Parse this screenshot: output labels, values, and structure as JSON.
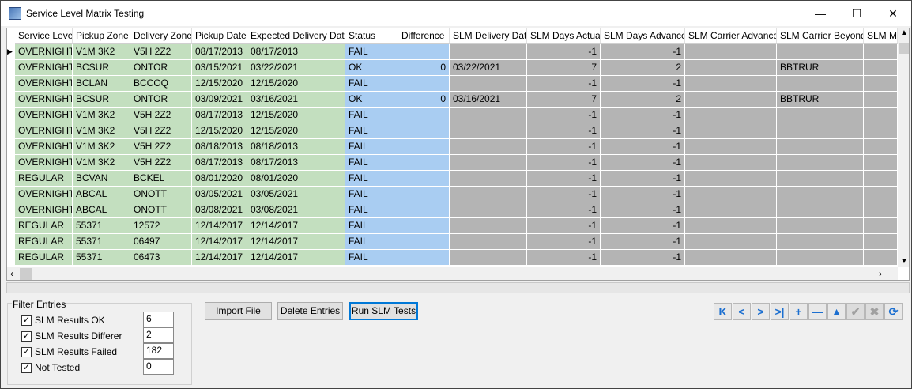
{
  "window": {
    "title": "Service Level Matrix Testing",
    "minimize": "—",
    "maximize": "☐",
    "close": "✕"
  },
  "grid": {
    "columns": [
      "Service Level",
      "Pickup Zone",
      "Delivery Zone",
      "Pickup Date",
      "Expected Delivery Date",
      "Status",
      "Difference",
      "SLM Delivery Date",
      "SLM Days Actual",
      "SLM Days Advance",
      "SLM Carrier Advance",
      "SLM Carrier Beyond",
      "SLM Ma"
    ],
    "rows": [
      [
        "OVERNIGHT",
        "V1M 3K2",
        "V5H 2Z2",
        "08/17/2013",
        "08/17/2013",
        "FAIL",
        "",
        "",
        "-1",
        "-1",
        "",
        "",
        ""
      ],
      [
        "OVERNIGHT",
        "BCSUR",
        "ONTOR",
        "03/15/2021",
        "03/22/2021",
        "OK",
        "0",
        "03/22/2021",
        "7",
        "2",
        "",
        "BBTRUR",
        ""
      ],
      [
        "OVERNIGHT",
        "BCLAN",
        "BCCOQ",
        "12/15/2020",
        "12/15/2020",
        "FAIL",
        "",
        "",
        "-1",
        "-1",
        "",
        "",
        ""
      ],
      [
        "OVERNIGHT",
        "BCSUR",
        "ONTOR",
        "03/09/2021",
        "03/16/2021",
        "OK",
        "0",
        "03/16/2021",
        "7",
        "2",
        "",
        "BBTRUR",
        ""
      ],
      [
        "OVERNIGHT",
        "V1M 3K2",
        "V5H 2Z2",
        "08/17/2013",
        "12/15/2020",
        "FAIL",
        "",
        "",
        "-1",
        "-1",
        "",
        "",
        ""
      ],
      [
        "OVERNIGHT",
        "V1M 3K2",
        "V5H 2Z2",
        "12/15/2020",
        "12/15/2020",
        "FAIL",
        "",
        "",
        "-1",
        "-1",
        "",
        "",
        ""
      ],
      [
        "OVERNIGHT",
        "V1M 3K2",
        "V5H 2Z2",
        "08/18/2013",
        "08/18/2013",
        "FAIL",
        "",
        "",
        "-1",
        "-1",
        "",
        "",
        ""
      ],
      [
        "OVERNIGHT",
        "V1M 3K2",
        "V5H 2Z2",
        "08/17/2013",
        "08/17/2013",
        "FAIL",
        "",
        "",
        "-1",
        "-1",
        "",
        "",
        ""
      ],
      [
        "REGULAR",
        "BCVAN",
        "BCKEL",
        "08/01/2020",
        "08/01/2020",
        "FAIL",
        "",
        "",
        "-1",
        "-1",
        "",
        "",
        ""
      ],
      [
        "OVERNIGHT",
        "ABCAL",
        "ONOTT",
        "03/05/2021",
        "03/05/2021",
        "FAIL",
        "",
        "",
        "-1",
        "-1",
        "",
        "",
        ""
      ],
      [
        "OVERNIGHT",
        "ABCAL",
        "ONOTT",
        "03/08/2021",
        "03/08/2021",
        "FAIL",
        "",
        "",
        "-1",
        "-1",
        "",
        "",
        ""
      ],
      [
        "REGULAR",
        "55371",
        "12572",
        "12/14/2017",
        "12/14/2017",
        "FAIL",
        "",
        "",
        "-1",
        "-1",
        "",
        "",
        ""
      ],
      [
        "REGULAR",
        "55371",
        "06497",
        "12/14/2017",
        "12/14/2017",
        "FAIL",
        "",
        "",
        "-1",
        "-1",
        "",
        "",
        ""
      ],
      [
        "REGULAR",
        "55371",
        "06473",
        "12/14/2017",
        "12/14/2017",
        "FAIL",
        "",
        "",
        "-1",
        "-1",
        "",
        "",
        ""
      ]
    ]
  },
  "filter": {
    "title": "Filter Entries",
    "items": [
      {
        "label": "SLM Results OK",
        "checked": true,
        "count": "6"
      },
      {
        "label": "SLM Results Differer",
        "checked": true,
        "count": "2"
      },
      {
        "label": "SLM Results Failed",
        "checked": true,
        "count": "182"
      },
      {
        "label": "Not Tested",
        "checked": true,
        "count": "0"
      }
    ]
  },
  "buttons": {
    "import": "Import File",
    "delete": "Delete Entries",
    "run": "Run SLM Tests"
  },
  "navigator": [
    {
      "icon": "first-record-icon",
      "glyph": "K",
      "enabled": true
    },
    {
      "icon": "prior-record-icon",
      "glyph": "<",
      "enabled": true
    },
    {
      "icon": "next-record-icon",
      "glyph": ">",
      "enabled": true
    },
    {
      "icon": "last-record-icon",
      "glyph": ">|",
      "enabled": true
    },
    {
      "icon": "insert-record-icon",
      "glyph": "+",
      "enabled": true
    },
    {
      "icon": "delete-record-icon",
      "glyph": "—",
      "enabled": true
    },
    {
      "icon": "edit-record-icon",
      "glyph": "▲",
      "enabled": true
    },
    {
      "icon": "post-edit-icon",
      "glyph": "✔",
      "enabled": false
    },
    {
      "icon": "cancel-edit-icon",
      "glyph": "✖",
      "enabled": false
    },
    {
      "icon": "refresh-icon",
      "glyph": "⟳",
      "enabled": true
    }
  ],
  "colors": {
    "input_cols": "#c3dfbf",
    "result_cols": "#a9cdf2",
    "slm_cols": "#b4b4b4",
    "focus": "#0078d7"
  }
}
